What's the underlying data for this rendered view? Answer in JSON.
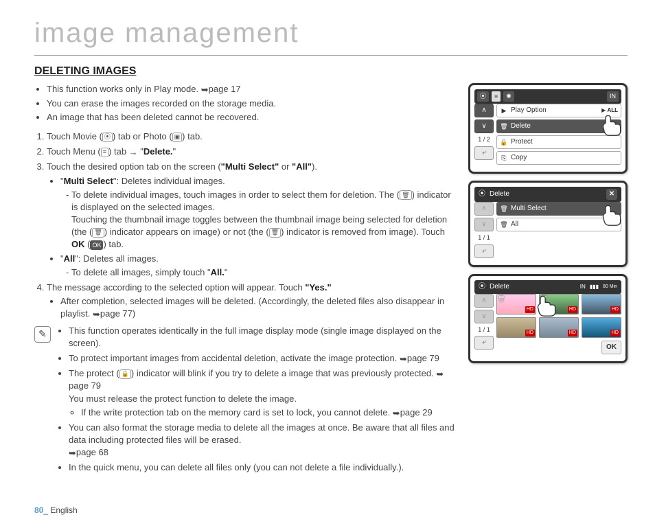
{
  "page": {
    "number": "80",
    "language": "English"
  },
  "chapter_title": "image management",
  "section_title": "DELETING IMAGES",
  "ref_pages": {
    "playmode": "page 17",
    "playlist": "page 77",
    "protect1": "page 79",
    "protect2": "page 79",
    "format": "page 68",
    "writeprotect": "page 29"
  },
  "top_bullets": [
    "This function works only in Play mode. ",
    "You can erase the images recorded on the storage media.",
    "An image that has been deleted cannot be recovered."
  ],
  "steps": {
    "s1_a": "Touch Movie (",
    "s1_b": ") tab or Photo (",
    "s1_c": ") tab.",
    "s2_a": "Touch Menu (",
    "s2_b": ") tab ",
    "s2_c": "\"",
    "s2_delete": "Delete.",
    "s2_d": "\"",
    "s3_a": "Touch the desired option tab on the screen (",
    "s3_ms": "\"Multi Select\"",
    "s3_or": " or ",
    "s3_all_q": "\"All\"",
    "s3_b": ").",
    "s3_ms_label": "Multi Select",
    "s3_ms_desc": "\": Deletes individual images.",
    "s3_ms_sub1_a": "To delete individual images, touch images in order to select them for deletion. The (",
    "s3_ms_sub1_b": ") indicator is displayed on the selected images.",
    "s3_ms_sub1_c": "Touching the thumbnail image toggles between the thumbnail image being selected for deletion (the (",
    "s3_ms_sub1_d": ") indicator appears on image) or not (the (",
    "s3_ms_sub1_e": ") indicator is removed from image). Touch ",
    "s3_ms_ok": "OK",
    "s3_ms_ok_b": " (",
    "s3_ms_ok_c": ") tab.",
    "s3_all_label": "All",
    "s3_all_desc": "\": Deletes all images.",
    "s3_all_sub": "To delete all images, simply touch \"",
    "s3_all_sub_b": "All.",
    "s4_a": "The message according to the selected option will appear. Touch ",
    "s4_yes": "\"Yes.\"",
    "s4_sub_a": "After completion, selected images will be deleted. (Accordingly, the deleted files also disappear in playlist. ",
    "s4_sub_b": ")"
  },
  "notes": {
    "n1": "This function operates identically in the full image display mode (single image displayed on the screen).",
    "n2_a": "To protect important images from accidental deletion, activate the image protection. ",
    "n3_a": "The protect (",
    "n3_b": ") indicator will blink if you try to delete a image that was previously protected. ",
    "n3_c": "You must release the protect function to delete the image.",
    "n3_sub_a": "If the write protection tab on the memory card is set to lock, you cannot delete. ",
    "n4_a": "You can also format the storage media to delete all the images at once. Be aware that all files and data including protected files will be erased. ",
    "n5": "In the quick menu, you can delete all files only (you can not delete a file individually.)."
  },
  "screen1": {
    "page_indicator": "1 / 2",
    "items": {
      "play_option": "Play Option",
      "play_option_val": "ALL",
      "delete": "Delete",
      "protect": "Protect",
      "copy": "Copy"
    }
  },
  "screen2": {
    "title": "Delete",
    "page_indicator": "1 / 1",
    "items": {
      "multi_select": "Multi Select",
      "all": "All"
    }
  },
  "screen3": {
    "title": "Delete",
    "page_indicator": "1 / 1",
    "time": "80 Min",
    "ok": "OK"
  }
}
